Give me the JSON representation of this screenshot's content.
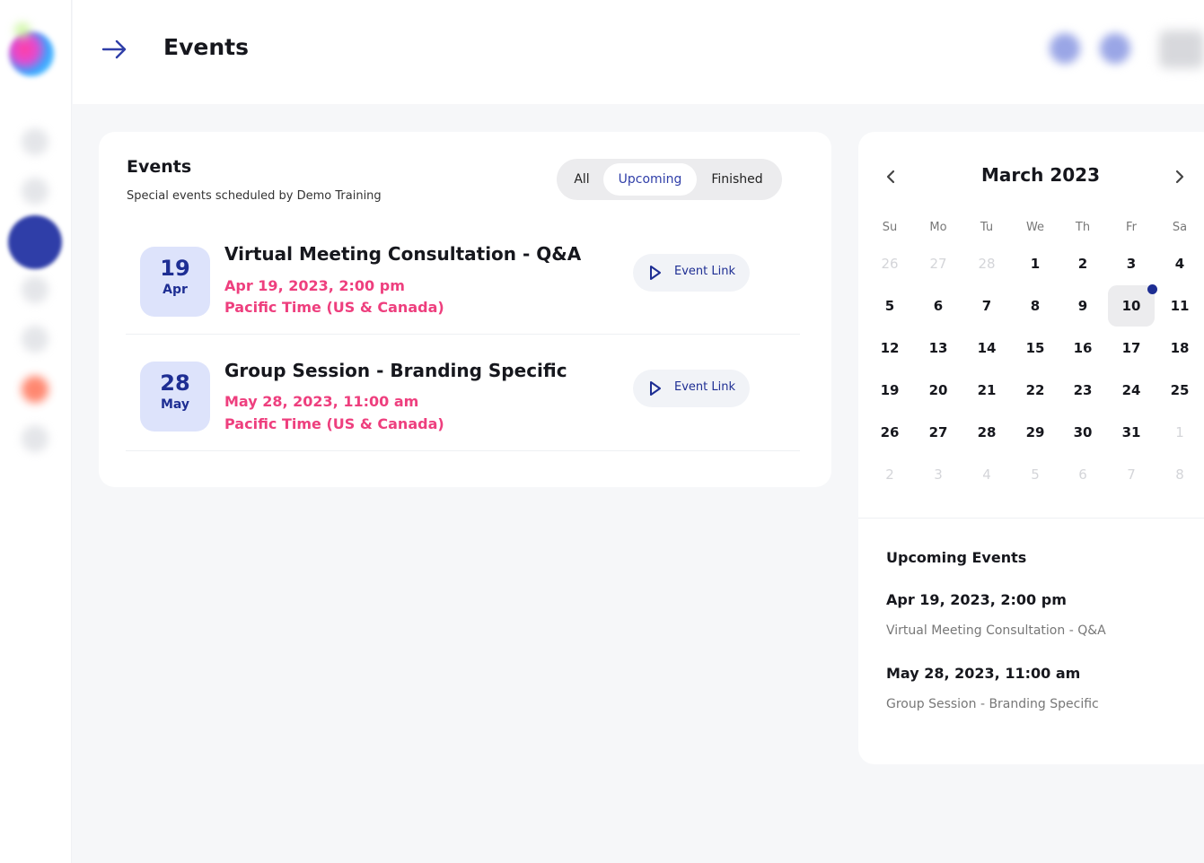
{
  "header": {
    "title": "Events"
  },
  "events_panel": {
    "title": "Events",
    "subtitle": "Special events scheduled by Demo Training",
    "filters": [
      {
        "label": "All",
        "active": false
      },
      {
        "label": "Upcoming",
        "active": true
      },
      {
        "label": "Finished",
        "active": false
      }
    ],
    "events": [
      {
        "day": "19",
        "month": "Apr",
        "name": "Virtual Meeting Consultation - Q&A",
        "time": "Apr 19, 2023, 2:00 pm",
        "timezone": "Pacific Time (US & Canada)",
        "link_label": "Event Link"
      },
      {
        "day": "28",
        "month": "May",
        "name": "Group Session - Branding Specific",
        "time": "May 28, 2023, 11:00 am",
        "timezone": "Pacific Time (US & Canada)",
        "link_label": "Event Link"
      }
    ]
  },
  "calendar": {
    "month_label": "March 2023",
    "weekdays": [
      "Su",
      "Mo",
      "Tu",
      "We",
      "Th",
      "Fr",
      "Sa"
    ],
    "weeks": [
      [
        "26",
        "27",
        "28",
        "1",
        "2",
        "3",
        "4"
      ],
      [
        "5",
        "6",
        "7",
        "8",
        "9",
        "10",
        "11"
      ],
      [
        "12",
        "13",
        "14",
        "15",
        "16",
        "17",
        "18"
      ],
      [
        "19",
        "20",
        "21",
        "22",
        "23",
        "24",
        "25"
      ],
      [
        "26",
        "27",
        "28",
        "29",
        "30",
        "31",
        "1"
      ],
      [
        "2",
        "3",
        "4",
        "5",
        "6",
        "7",
        "8"
      ]
    ],
    "today": "10",
    "upcoming_title": "Upcoming Events",
    "upcoming": [
      {
        "date": "Apr 19, 2023, 2:00 pm",
        "name": "Virtual Meeting Consultation - Q&A"
      },
      {
        "date": "May 28, 2023, 11:00 am",
        "name": "Group Session - Branding Specific"
      }
    ]
  },
  "colors": {
    "accent": "#1e2e93",
    "pink": "#ee3f7e",
    "badge_bg": "#dde3fb"
  }
}
